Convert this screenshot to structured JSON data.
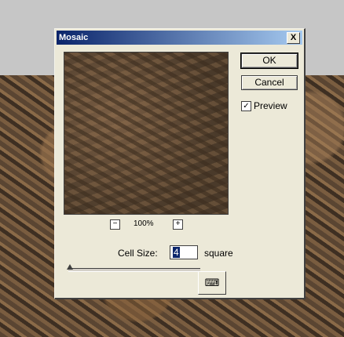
{
  "dialog": {
    "title": "Mosaic",
    "close_label": "X",
    "zoom": {
      "minus": "−",
      "value": "100%",
      "plus": "+"
    },
    "ok_label": "OK",
    "cancel_label": "Cancel",
    "preview": {
      "label": "Preview",
      "checked": true,
      "check_glyph": "✓"
    },
    "cell_size": {
      "label": "Cell Size:",
      "value": "4",
      "unit": "square"
    },
    "keyboard_glyph": "⌨"
  }
}
